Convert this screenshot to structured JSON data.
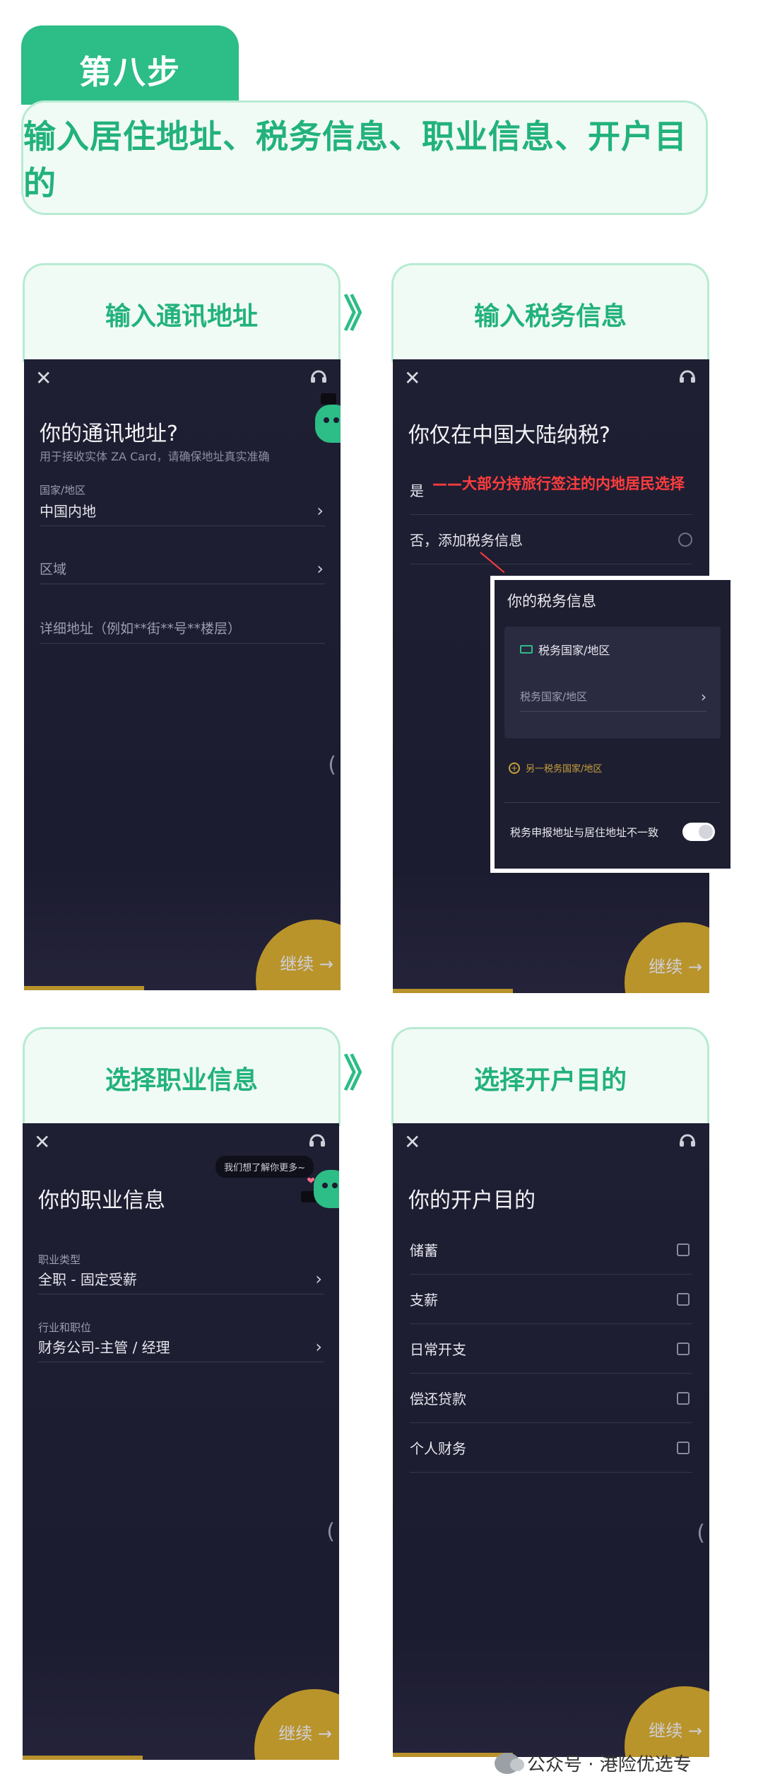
{
  "step": {
    "tab_label": "第八步",
    "title": "输入居住地址、税务信息、职业信息、开户目的"
  },
  "panels": {
    "address": {
      "label": "输入通讯地址",
      "title": "你的通讯地址?",
      "subtitle": "用于接收实体 ZA Card，请确保地址真实准确",
      "country_label": "国家/地区",
      "country_value": "中国内地",
      "district_value": "区域",
      "detail_placeholder": "详细地址（例如**街**号**楼层）",
      "continue_label": "继续 →"
    },
    "tax": {
      "label": "输入税务信息",
      "title": "你仅在中国大陆纳税?",
      "option_yes": "是",
      "option_no": "否，添加税务信息",
      "annotation": "——大部分持旅行签注的内地居民选择",
      "continue_label": "继续 →",
      "popup": {
        "title": "你的税务信息",
        "card_head": "税务国家/地区",
        "select_placeholder": "税务国家/地区",
        "add_label": "另一税务国家/地区",
        "toggle_label": "税务申报地址与居住地址不一致"
      }
    },
    "occupation": {
      "label": "选择职业信息",
      "bubble": "我们想了解你更多~",
      "title": "你的职业信息",
      "type_label": "职业类型",
      "type_value": "全职 - 固定受薪",
      "industry_label": "行业和职位",
      "industry_value": "财务公司-主管 / 经理",
      "continue_label": "继续 →"
    },
    "purpose": {
      "label": "选择开户目的",
      "title": "你的开户目的",
      "options": [
        "储蓄",
        "支薪",
        "日常开支",
        "偿还贷款",
        "个人财务"
      ],
      "continue_label": "继续 →"
    }
  },
  "icons": {
    "close": "close-icon",
    "support": "headset-icon",
    "arrow": "double-chevron-right-icon"
  },
  "ui": {
    "arrow_glyph": "》",
    "chevron": "›",
    "close_glyph": "✕",
    "scroll_glyph": "(",
    "plus_glyph": "+",
    "heart_glyph": "❤"
  },
  "watermark": "公众号 · 港险优选专"
}
